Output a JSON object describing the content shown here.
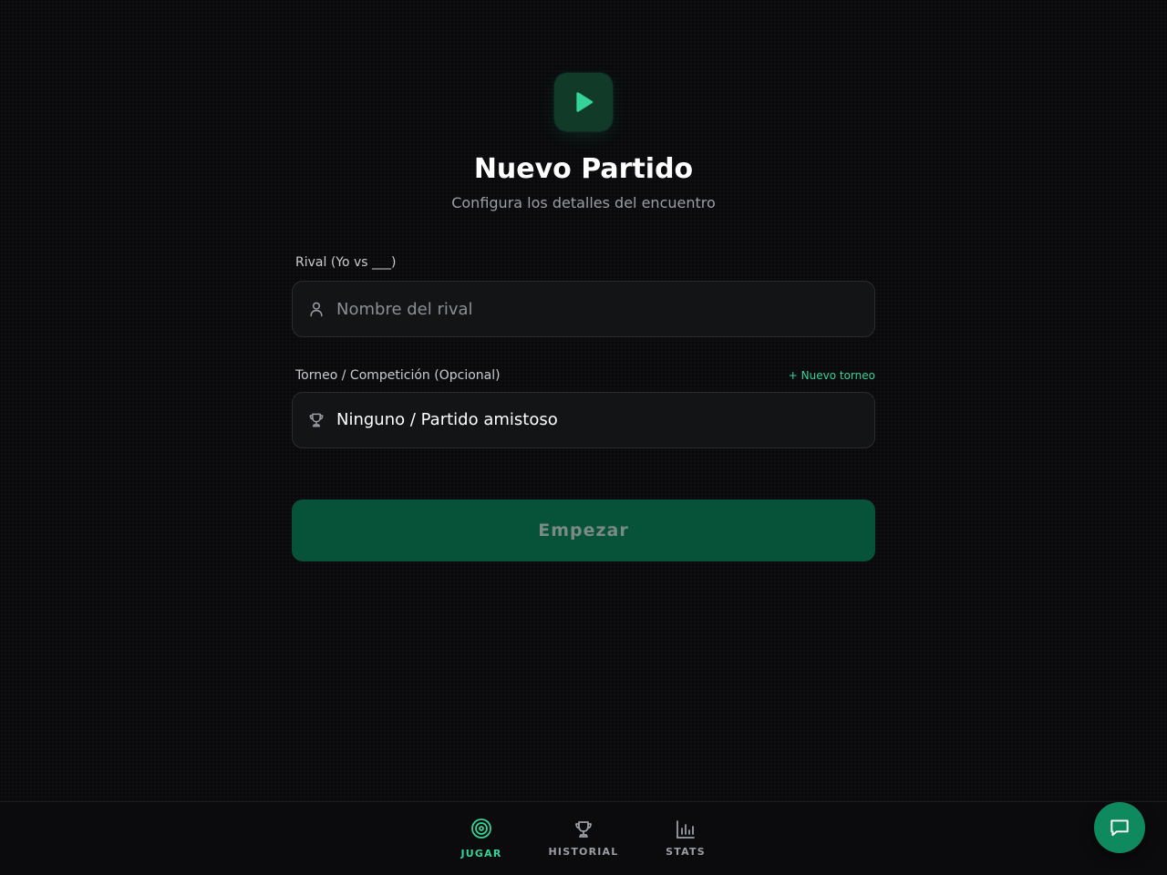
{
  "header": {
    "logo_icon": "play-icon",
    "title": "Nuevo Partido",
    "subtitle": "Configura los detalles del encuentro"
  },
  "form": {
    "rival": {
      "label": "Rival (Yo vs ___)",
      "placeholder": "Nombre del rival",
      "value": "",
      "icon": "user-icon"
    },
    "tournament": {
      "label": "Torneo / Competición (Opcional)",
      "new_link": "+ Nuevo torneo",
      "selected": "Ninguno / Partido amistoso",
      "icon": "trophy-icon"
    },
    "submit_label": "Empezar"
  },
  "nav": {
    "items": [
      {
        "label": "JUGAR",
        "icon": "target-icon",
        "active": true
      },
      {
        "label": "HISTORIAL",
        "icon": "trophy-icon",
        "active": false
      },
      {
        "label": "STATS",
        "icon": "bar-chart-icon",
        "active": false
      }
    ]
  },
  "chat": {
    "icon": "chat-icon"
  },
  "colors": {
    "background": "#0a0a0c",
    "accent": "#34d399",
    "button": "#065339",
    "fab": "#0f8a5f"
  }
}
